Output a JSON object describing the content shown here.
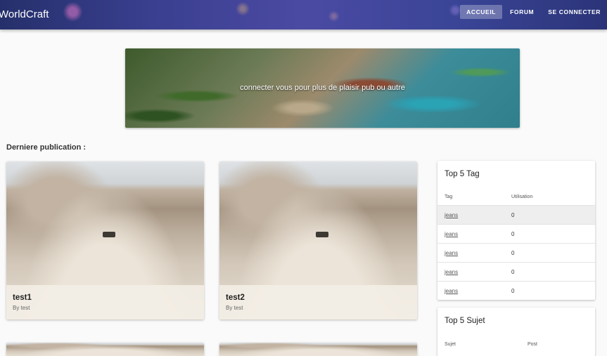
{
  "header": {
    "brand": "WorldCraft",
    "nav": [
      {
        "label": "ACCUEIL",
        "active": true
      },
      {
        "label": "FORUM",
        "active": false
      },
      {
        "label": "SE CONNECTER",
        "active": false
      }
    ]
  },
  "banner": {
    "text": "connecter vous pour plus de plaisir pub ou autre"
  },
  "main": {
    "section_title": "Derniere publication :",
    "posts": [
      {
        "title": "test1",
        "author": "By test"
      },
      {
        "title": "test2",
        "author": "By test"
      }
    ]
  },
  "sidebar": {
    "tags": {
      "title": "Top 5 Tag",
      "columns": [
        "Tag",
        "Utilisation"
      ],
      "rows": [
        {
          "tag": "jeans",
          "count": "0"
        },
        {
          "tag": "jeans",
          "count": "0"
        },
        {
          "tag": "jeans",
          "count": "0"
        },
        {
          "tag": "jeans",
          "count": "0"
        },
        {
          "tag": "jeans",
          "count": "0"
        }
      ]
    },
    "subjects": {
      "title": "Top 5 Sujet",
      "columns": [
        "Sujet",
        "Post"
      ]
    }
  }
}
